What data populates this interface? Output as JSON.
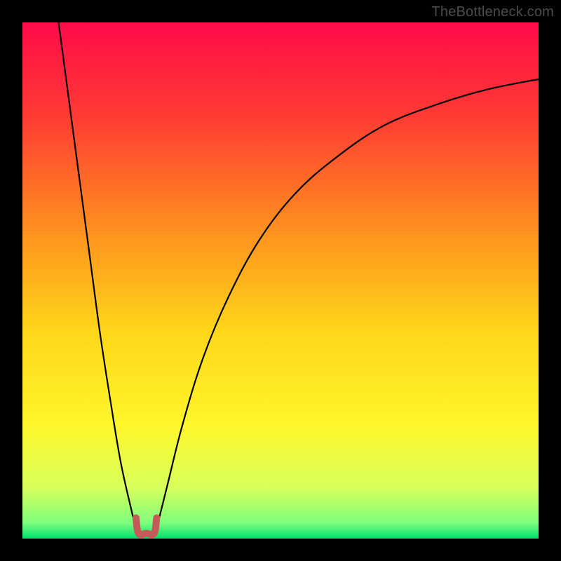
{
  "watermark": "TheBottleneck.com",
  "chart_data": {
    "type": "line",
    "title": "",
    "xlabel": "",
    "ylabel": "",
    "xlim": [
      0,
      100
    ],
    "ylim": [
      0,
      100
    ],
    "background": {
      "type": "vertical-gradient",
      "stops": [
        {
          "pos": 0.0,
          "color": "#ff0b49"
        },
        {
          "pos": 0.18,
          "color": "#ff3a34"
        },
        {
          "pos": 0.4,
          "color": "#ff8f1f"
        },
        {
          "pos": 0.6,
          "color": "#ffd71a"
        },
        {
          "pos": 0.78,
          "color": "#fff62b"
        },
        {
          "pos": 0.9,
          "color": "#d8ff5a"
        },
        {
          "pos": 0.97,
          "color": "#7dff7d"
        },
        {
          "pos": 1.0,
          "color": "#00e06b"
        }
      ]
    },
    "series": [
      {
        "name": "left-branch",
        "stroke": "#000000",
        "points": [
          {
            "x": 7,
            "y": 100
          },
          {
            "x": 9,
            "y": 85
          },
          {
            "x": 11,
            "y": 70
          },
          {
            "x": 13,
            "y": 55
          },
          {
            "x": 15,
            "y": 40
          },
          {
            "x": 17,
            "y": 27
          },
          {
            "x": 19,
            "y": 15
          },
          {
            "x": 21,
            "y": 6
          },
          {
            "x": 22,
            "y": 2
          }
        ]
      },
      {
        "name": "right-branch",
        "stroke": "#000000",
        "points": [
          {
            "x": 26,
            "y": 2
          },
          {
            "x": 28,
            "y": 10
          },
          {
            "x": 31,
            "y": 22
          },
          {
            "x": 35,
            "y": 35
          },
          {
            "x": 40,
            "y": 47
          },
          {
            "x": 46,
            "y": 58
          },
          {
            "x": 53,
            "y": 67
          },
          {
            "x": 61,
            "y": 74
          },
          {
            "x": 70,
            "y": 80
          },
          {
            "x": 80,
            "y": 84
          },
          {
            "x": 90,
            "y": 87
          },
          {
            "x": 100,
            "y": 89
          }
        ]
      },
      {
        "name": "minimum-marker",
        "stroke": "#c65a5a",
        "stroke_width": 10,
        "points": [
          {
            "x": 22.0,
            "y": 4.0
          },
          {
            "x": 22.5,
            "y": 1.0
          },
          {
            "x": 24.0,
            "y": 1.0
          },
          {
            "x": 25.5,
            "y": 1.0
          },
          {
            "x": 26.0,
            "y": 4.0
          }
        ]
      }
    ]
  }
}
